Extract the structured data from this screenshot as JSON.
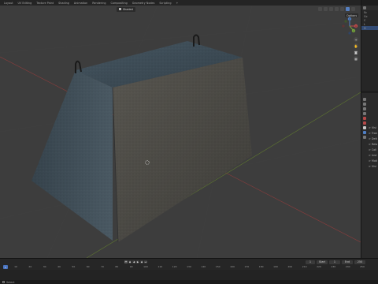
{
  "workspace_tabs": [
    {
      "label": "Layout",
      "active": false
    },
    {
      "label": "UV Editing",
      "active": false
    },
    {
      "label": "Texture Paint",
      "active": false
    },
    {
      "label": "Shading",
      "active": false
    },
    {
      "label": "Animation",
      "active": false
    },
    {
      "label": "Rendering",
      "active": false
    },
    {
      "label": "Compositing",
      "active": false
    },
    {
      "label": "Geometry Nodes",
      "active": false
    },
    {
      "label": "Scripting",
      "active": false
    },
    {
      "label": "+",
      "active": false
    }
  ],
  "viewport": {
    "mode_label": "Shaded",
    "options_label": "Options",
    "gizmo_axes": {
      "x": "X",
      "y": "Y",
      "z": "Z"
    },
    "colors": {
      "background": "#3d3d3d",
      "axis_red": "#b04a4a",
      "axis_green": "#6f8d3a",
      "concrete_top": "#3d4a52",
      "concrete_front": "#4b4a45",
      "concrete_left": "#3f4d57"
    }
  },
  "outliner": {
    "rows": [
      {
        "label": "Sc",
        "selected": false
      },
      {
        "label": "Co",
        "selected": false
      },
      {
        "label": "C",
        "selected": false
      },
      {
        "label": "L",
        "selected": false
      },
      {
        "label": "O",
        "selected": true
      }
    ]
  },
  "properties": {
    "rows": [
      "> Visi",
      "> Tran",
      "> Delt",
      "> Rela",
      "> Coll",
      "> Inst",
      "> Moti",
      "> Visi"
    ]
  },
  "timeline": {
    "playback_icons": [
      "first-frame-icon",
      "prev-keyframe-icon",
      "play-reverse-icon",
      "play-icon",
      "next-keyframe-icon",
      "last-frame-icon"
    ],
    "current_frame": "1",
    "start_label": "Start",
    "start": "1",
    "end_label": "End",
    "end": "250",
    "ruler_ticks": [
      "10",
      "20",
      "30",
      "40",
      "50",
      "60",
      "70",
      "80",
      "90",
      "100",
      "110",
      "120",
      "130",
      "140",
      "150",
      "160",
      "170",
      "180",
      "190",
      "200",
      "210",
      "220",
      "230",
      "240",
      "250"
    ]
  },
  "statusbar": {
    "label": "Select"
  }
}
